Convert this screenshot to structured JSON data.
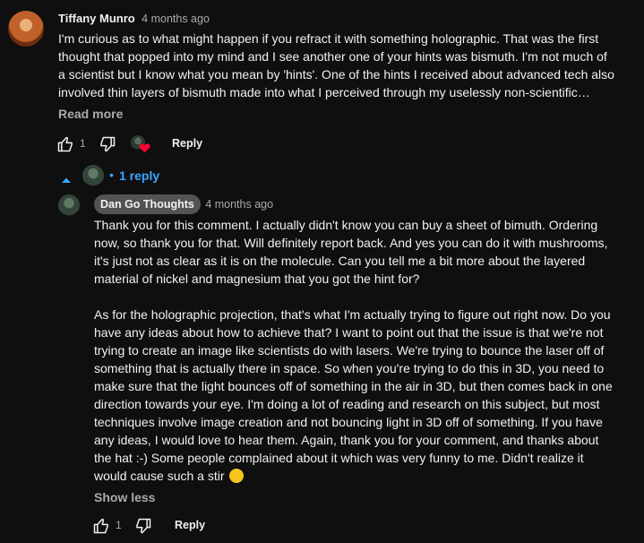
{
  "comment": {
    "author": "Tiffany Munro",
    "time": "4 months ago",
    "text": "I'm curious as to what might happen if you refract it with something holographic. That was the first thought that popped into my mind and I see another one of your hints was bismuth. I'm not much of a scientist but I know what you mean by 'hints'. One of the hints I received about advanced tech also involved thin layers of bismuth made into what I perceived through my uselessly non-scientific mind...",
    "read_more": "Read more",
    "like_count": "1",
    "reply_label": "Reply",
    "replies_toggle": "1 reply",
    "replies_separator": "•"
  },
  "reply": {
    "author": "Dan Go Thoughts",
    "time": "4 months ago",
    "paragraph1": "Thank you for this comment. I actually didn't know you can buy a sheet of bimuth. Ordering now, so thank you for that. Will definitely report back. And yes you can do it with mushrooms, it's just not as clear as it is on the molecule. Can you tell me a bit more about the layered material of nickel and magnesium that you got the hint for?",
    "paragraph2": "As for the holographic projection, that's what I'm actually trying to figure out right now. Do you have any ideas about how to achieve that? I want to point out that the issue is that we're not trying to create an image like scientists do with lasers. We're trying to bounce the laser off of something that is actually there in space. So when you're trying to do this in 3D, you need to make sure that the light bounces off of something in the air in 3D, but then comes back in one direction towards your eye. I'm doing a lot of reading and research on this subject, but most techniques involve image creation and not bouncing light in 3D off of something. If you have any ideas, I would love to hear them. Again, thank you for your comment, and thanks about the hat :-) Some people complained about it which was very funny to me. Didn't realize it would cause such a stir",
    "emoji": "😆",
    "show_less": "Show less",
    "like_count": "1",
    "reply_label": "Reply"
  },
  "colors": {
    "background": "#0f0f0f",
    "text": "#f1f1f1",
    "secondary": "#aaaaaa",
    "link_blue": "#3ea6ff",
    "badge": "#535353",
    "heart": "#ff0033"
  }
}
